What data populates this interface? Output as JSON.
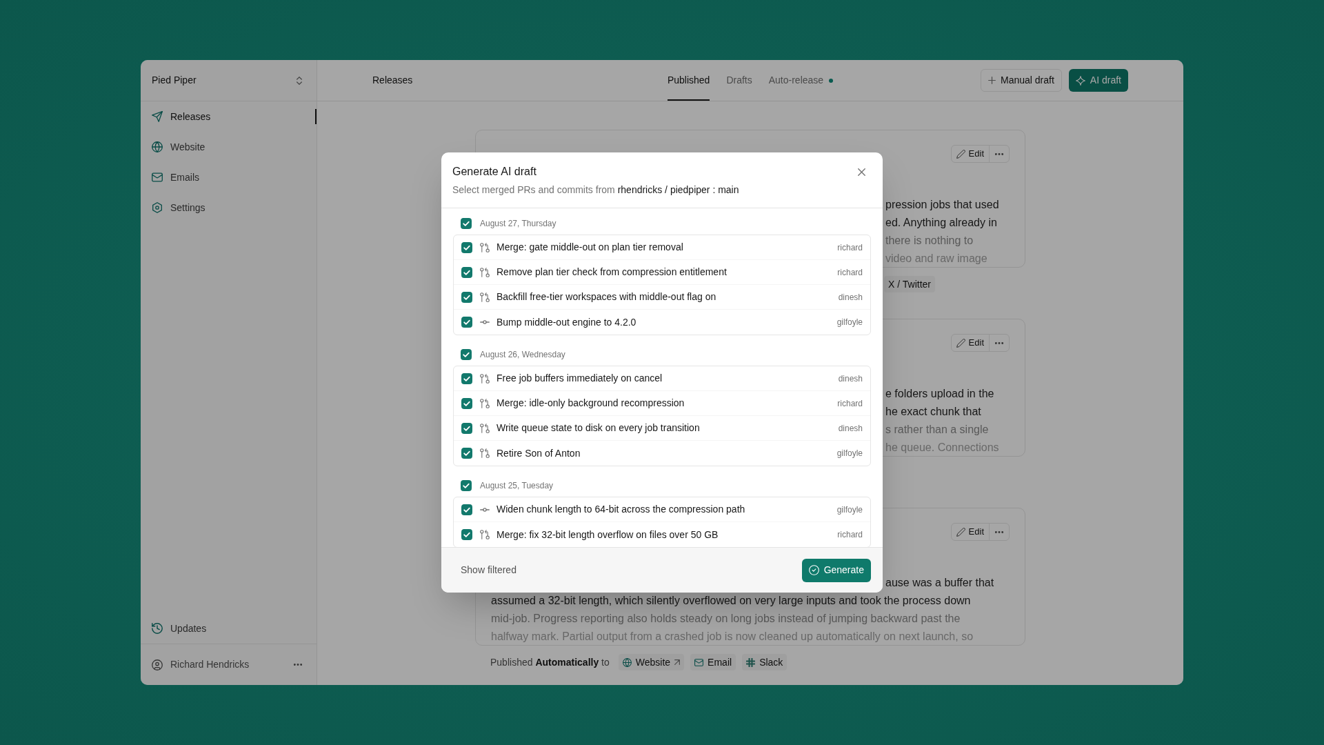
{
  "workspace": {
    "name": "Pied Piper"
  },
  "sidebar": {
    "items": [
      {
        "label": "Releases",
        "selected": true
      },
      {
        "label": "Website",
        "selected": false
      },
      {
        "label": "Emails",
        "selected": false
      },
      {
        "label": "Settings",
        "selected": false
      }
    ],
    "footer_items": [
      {
        "label": "Updates"
      }
    ],
    "user": {
      "name": "Richard Hendricks"
    }
  },
  "header": {
    "title": "Releases",
    "tabs": [
      {
        "label": "Published",
        "selected": true,
        "dot": false
      },
      {
        "label": "Drafts",
        "selected": false,
        "dot": false
      },
      {
        "label": "Auto-release",
        "selected": false,
        "dot": true
      }
    ],
    "buttons": [
      {
        "label": "Manual draft",
        "kind": "secondary"
      },
      {
        "label": "AI draft",
        "kind": "primary"
      }
    ]
  },
  "releases": [
    {
      "edit_label": "Edit",
      "lines": [
        {
          "kind": "fragment",
          "text": "pression jobs that used"
        },
        {
          "kind": "fragment",
          "text": "ed. Anything already in"
        },
        {
          "kind": "fragment",
          "text": "there is nothing to"
        },
        {
          "kind": "fragment",
          "text": "video and raw image"
        }
      ],
      "channels": [
        {
          "label": "X / Twitter",
          "kind": "plain"
        }
      ]
    },
    {
      "edit_label": "Edit",
      "lines": [
        {
          "kind": "fragment",
          "text": "e folders upload in the"
        },
        {
          "kind": "fragment",
          "text": "he exact chunk that"
        },
        {
          "kind": "fragment",
          "text": "s rather than a single"
        },
        {
          "kind": "fragment",
          "text": "he queue. Connections"
        }
      ]
    },
    {
      "edit_label": "Edit",
      "lines": [
        {
          "kind": "fragment",
          "text": "ause was a buffer that"
        },
        {
          "kind": "full",
          "text": "assumed a 32-bit length, which silently overflowed on very large inputs and took the process down"
        },
        {
          "kind": "full",
          "text": "mid-job. Progress reporting also holds steady on long jobs instead of jumping backward past the"
        },
        {
          "kind": "full",
          "text": "halfway mark. Partial output from a crashed job is now cleaned up automatically on next launch, so"
        }
      ],
      "published_text": "Published **Automatically** to",
      "channels": [
        {
          "label": "Website",
          "kind": "website"
        },
        {
          "label": "Email",
          "kind": "email"
        },
        {
          "label": "Slack",
          "kind": "slack"
        }
      ]
    }
  ],
  "dialog": {
    "title": "Generate AI draft",
    "subtitle": "Select merged PRs and commits from **rhendricks / piedpiper : main**",
    "groups": [
      {
        "date": "August 27, Thursday",
        "checked": true,
        "items": [
          {
            "kind": "pr",
            "title": "Merge: gate middle-out on plan tier removal",
            "author": "richard",
            "checked": true
          },
          {
            "kind": "pr",
            "title": "Remove plan tier check from compression entitlement",
            "author": "richard",
            "checked": true
          },
          {
            "kind": "pr",
            "title": "Backfill free-tier workspaces with middle-out flag on",
            "author": "dinesh",
            "checked": true
          },
          {
            "kind": "commit",
            "title": "Bump middle-out engine to 4.2.0",
            "author": "gilfoyle",
            "checked": true
          }
        ]
      },
      {
        "date": "August 26, Wednesday",
        "checked": true,
        "items": [
          {
            "kind": "pr",
            "title": "Free job buffers immediately on cancel",
            "author": "dinesh",
            "checked": true
          },
          {
            "kind": "pr",
            "title": "Merge: idle-only background recompression",
            "author": "richard",
            "checked": true
          },
          {
            "kind": "pr",
            "title": "Write queue state to disk on every job transition",
            "author": "dinesh",
            "checked": true
          },
          {
            "kind": "pr",
            "title": "Retire Son of Anton",
            "author": "gilfoyle",
            "checked": true
          }
        ]
      },
      {
        "date": "August 25, Tuesday",
        "checked": true,
        "items": [
          {
            "kind": "commit",
            "title": "Widen chunk length to 64-bit across the compression path",
            "author": "gilfoyle",
            "checked": true
          },
          {
            "kind": "pr",
            "title": "Merge: fix 32-bit length overflow on files over 50 GB",
            "author": "richard",
            "checked": true
          }
        ]
      }
    ],
    "footer": {
      "toggle": "Show filtered",
      "action": "Generate"
    }
  }
}
